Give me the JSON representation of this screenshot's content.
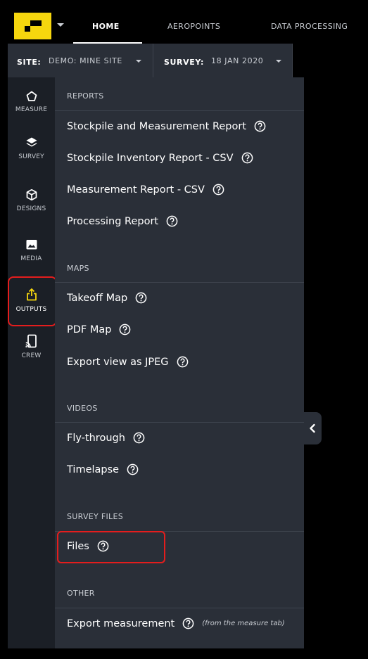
{
  "nav": {
    "tabs": [
      {
        "label": "HOME"
      },
      {
        "label": "AEROPOINTS"
      },
      {
        "label": "DATA PROCESSING"
      }
    ]
  },
  "filter": {
    "site_label": "SITE:",
    "site_value": "DEMO: MINE SITE",
    "survey_label": "SURVEY:",
    "survey_value": "18 JAN 2020"
  },
  "sidebar": {
    "items": [
      {
        "label": "MEASURE",
        "icon": "pentagon-icon"
      },
      {
        "label": "SURVEY",
        "icon": "layers-icon"
      },
      {
        "label": "DESIGNS",
        "icon": "cube-icon"
      },
      {
        "label": "MEDIA",
        "icon": "image-icon"
      },
      {
        "label": "OUTPUTS",
        "icon": "share-upload-icon"
      },
      {
        "label": "CREW",
        "icon": "cast-device-icon"
      }
    ]
  },
  "panel": {
    "sections": [
      {
        "title": "REPORTS",
        "items": [
          {
            "label": "Stockpile and Measurement Report"
          },
          {
            "label": "Stockpile Inventory Report - CSV"
          },
          {
            "label": "Measurement Report - CSV"
          },
          {
            "label": "Processing Report"
          }
        ]
      },
      {
        "title": "MAPS",
        "items": [
          {
            "label": "Takeoff Map"
          },
          {
            "label": "PDF Map"
          },
          {
            "label": "Export view as JPEG"
          }
        ]
      },
      {
        "title": "VIDEOS",
        "items": [
          {
            "label": "Fly-through"
          },
          {
            "label": "Timelapse"
          }
        ]
      },
      {
        "title": "SURVEY FILES",
        "items": [
          {
            "label": "Files"
          }
        ]
      },
      {
        "title": "OTHER",
        "items": [
          {
            "label": "Export measurement",
            "note": "(from the measure tab)"
          }
        ]
      }
    ]
  },
  "colors": {
    "brand": "#f6d60e",
    "panel_bg": "#2a2f38",
    "sidebar_bg": "#1b1f26",
    "active_accent": "#f6d60e",
    "highlight": "#e41d1d"
  }
}
